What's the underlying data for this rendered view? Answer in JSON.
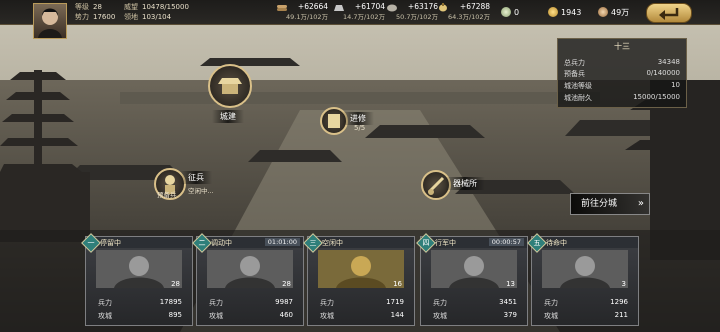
{
  "player": {
    "stats": [
      {
        "label": "等级",
        "value": "28"
      },
      {
        "label": "威望",
        "value": "10478/15000"
      },
      {
        "label": "势力",
        "value": "17600"
      },
      {
        "label": "领地",
        "value": "103/104"
      }
    ]
  },
  "resources": [
    {
      "amount": "+62664",
      "stock": "49.1万/102万",
      "icon": "wood-icon"
    },
    {
      "amount": "+61704",
      "stock": "14.7万/102万",
      "icon": "iron-icon"
    },
    {
      "amount": "+63176",
      "stock": "50.7万/102万",
      "icon": "stone-icon"
    },
    {
      "amount": "+67288",
      "stock": "64.3万/102万",
      "icon": "grain-icon"
    }
  ],
  "currency": {
    "jade": "0",
    "gold": "1943",
    "copper": "49万"
  },
  "city_panel": {
    "title": "十三",
    "rows": [
      {
        "label": "总兵力",
        "value": "34348"
      },
      {
        "label": "预备兵",
        "value": "0/140000"
      },
      {
        "label": "城池等级",
        "value": "10"
      },
      {
        "label": "城池耐久",
        "value": "15000/15000"
      }
    ]
  },
  "buildings": {
    "construction": "城建",
    "upgrade": "进修",
    "upgrade_count": "5/5",
    "recruit": "征兵",
    "recruit_status": "空闲中...",
    "recruit_tag": "预备兵",
    "armory": "器械所"
  },
  "goto_button": "前往分城",
  "armies": [
    {
      "badge": "一",
      "badge_color": "#2f7f7a",
      "status": "停留中",
      "timer": "",
      "level": "28",
      "troops_label": "兵力",
      "troops": "17895",
      "siege_label": "攻城",
      "siege": "895"
    },
    {
      "badge": "二",
      "badge_color": "#2f7f7a",
      "status": "调动中",
      "timer": "01:01:00",
      "level": "28",
      "troops_label": "兵力",
      "troops": "9987",
      "siege_label": "攻城",
      "siege": "460"
    },
    {
      "badge": "三",
      "badge_color": "#2f7f7a",
      "status": "空闲中",
      "timer": "",
      "level": "16",
      "troops_label": "兵力",
      "troops": "1719",
      "siege_label": "攻城",
      "siege": "144"
    },
    {
      "badge": "四",
      "badge_color": "#2f7f7a",
      "status": "行军中",
      "timer": "00:00:57",
      "level": "13",
      "troops_label": "兵力",
      "troops": "3451",
      "siege_label": "攻城",
      "siege": "379"
    },
    {
      "badge": "五",
      "badge_color": "#2f7f7a",
      "status": "待命中",
      "timer": "",
      "level": "3",
      "troops_label": "兵力",
      "troops": "1296",
      "siege_label": "攻城",
      "siege": "211"
    }
  ]
}
